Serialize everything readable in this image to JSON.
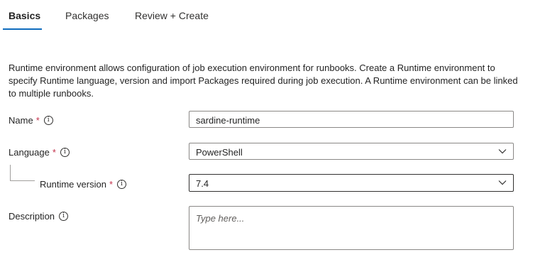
{
  "tabs": [
    {
      "label": "Basics",
      "active": true
    },
    {
      "label": "Packages",
      "active": false
    },
    {
      "label": "Review + Create",
      "active": false
    }
  ],
  "description": "Runtime environment allows configuration of job execution environment for runbooks. Create a Runtime environment to specify Runtime language, version and import Packages required during job execution. A Runtime environment can be linked to multiple runbooks.",
  "form": {
    "name": {
      "label": "Name",
      "required_mark": "*",
      "value": "sardine-runtime"
    },
    "language": {
      "label": "Language",
      "required_mark": "*",
      "value": "PowerShell"
    },
    "runtime_version": {
      "label": "Runtime version",
      "required_mark": "*",
      "value": "7.4"
    },
    "description": {
      "label": "Description",
      "placeholder": "Type here..."
    }
  },
  "info_icon_glyph": "i",
  "colors": {
    "accent": "#0f6cbd",
    "required": "#c4314b"
  }
}
